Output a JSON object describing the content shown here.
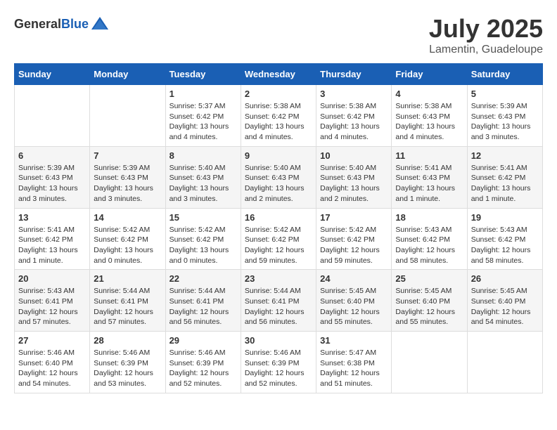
{
  "header": {
    "logo_general": "General",
    "logo_blue": "Blue",
    "month_year": "July 2025",
    "location": "Lamentin, Guadeloupe"
  },
  "days_of_week": [
    "Sunday",
    "Monday",
    "Tuesday",
    "Wednesday",
    "Thursday",
    "Friday",
    "Saturday"
  ],
  "weeks": [
    [
      {
        "day": "",
        "sunrise": "",
        "sunset": "",
        "daylight": ""
      },
      {
        "day": "",
        "sunrise": "",
        "sunset": "",
        "daylight": ""
      },
      {
        "day": "1",
        "sunrise": "Sunrise: 5:37 AM",
        "sunset": "Sunset: 6:42 PM",
        "daylight": "Daylight: 13 hours and 4 minutes."
      },
      {
        "day": "2",
        "sunrise": "Sunrise: 5:38 AM",
        "sunset": "Sunset: 6:42 PM",
        "daylight": "Daylight: 13 hours and 4 minutes."
      },
      {
        "day": "3",
        "sunrise": "Sunrise: 5:38 AM",
        "sunset": "Sunset: 6:42 PM",
        "daylight": "Daylight: 13 hours and 4 minutes."
      },
      {
        "day": "4",
        "sunrise": "Sunrise: 5:38 AM",
        "sunset": "Sunset: 6:43 PM",
        "daylight": "Daylight: 13 hours and 4 minutes."
      },
      {
        "day": "5",
        "sunrise": "Sunrise: 5:39 AM",
        "sunset": "Sunset: 6:43 PM",
        "daylight": "Daylight: 13 hours and 3 minutes."
      }
    ],
    [
      {
        "day": "6",
        "sunrise": "Sunrise: 5:39 AM",
        "sunset": "Sunset: 6:43 PM",
        "daylight": "Daylight: 13 hours and 3 minutes."
      },
      {
        "day": "7",
        "sunrise": "Sunrise: 5:39 AM",
        "sunset": "Sunset: 6:43 PM",
        "daylight": "Daylight: 13 hours and 3 minutes."
      },
      {
        "day": "8",
        "sunrise": "Sunrise: 5:40 AM",
        "sunset": "Sunset: 6:43 PM",
        "daylight": "Daylight: 13 hours and 3 minutes."
      },
      {
        "day": "9",
        "sunrise": "Sunrise: 5:40 AM",
        "sunset": "Sunset: 6:43 PM",
        "daylight": "Daylight: 13 hours and 2 minutes."
      },
      {
        "day": "10",
        "sunrise": "Sunrise: 5:40 AM",
        "sunset": "Sunset: 6:43 PM",
        "daylight": "Daylight: 13 hours and 2 minutes."
      },
      {
        "day": "11",
        "sunrise": "Sunrise: 5:41 AM",
        "sunset": "Sunset: 6:43 PM",
        "daylight": "Daylight: 13 hours and 1 minute."
      },
      {
        "day": "12",
        "sunrise": "Sunrise: 5:41 AM",
        "sunset": "Sunset: 6:42 PM",
        "daylight": "Daylight: 13 hours and 1 minute."
      }
    ],
    [
      {
        "day": "13",
        "sunrise": "Sunrise: 5:41 AM",
        "sunset": "Sunset: 6:42 PM",
        "daylight": "Daylight: 13 hours and 1 minute."
      },
      {
        "day": "14",
        "sunrise": "Sunrise: 5:42 AM",
        "sunset": "Sunset: 6:42 PM",
        "daylight": "Daylight: 13 hours and 0 minutes."
      },
      {
        "day": "15",
        "sunrise": "Sunrise: 5:42 AM",
        "sunset": "Sunset: 6:42 PM",
        "daylight": "Daylight: 13 hours and 0 minutes."
      },
      {
        "day": "16",
        "sunrise": "Sunrise: 5:42 AM",
        "sunset": "Sunset: 6:42 PM",
        "daylight": "Daylight: 12 hours and 59 minutes."
      },
      {
        "day": "17",
        "sunrise": "Sunrise: 5:42 AM",
        "sunset": "Sunset: 6:42 PM",
        "daylight": "Daylight: 12 hours and 59 minutes."
      },
      {
        "day": "18",
        "sunrise": "Sunrise: 5:43 AM",
        "sunset": "Sunset: 6:42 PM",
        "daylight": "Daylight: 12 hours and 58 minutes."
      },
      {
        "day": "19",
        "sunrise": "Sunrise: 5:43 AM",
        "sunset": "Sunset: 6:42 PM",
        "daylight": "Daylight: 12 hours and 58 minutes."
      }
    ],
    [
      {
        "day": "20",
        "sunrise": "Sunrise: 5:43 AM",
        "sunset": "Sunset: 6:41 PM",
        "daylight": "Daylight: 12 hours and 57 minutes."
      },
      {
        "day": "21",
        "sunrise": "Sunrise: 5:44 AM",
        "sunset": "Sunset: 6:41 PM",
        "daylight": "Daylight: 12 hours and 57 minutes."
      },
      {
        "day": "22",
        "sunrise": "Sunrise: 5:44 AM",
        "sunset": "Sunset: 6:41 PM",
        "daylight": "Daylight: 12 hours and 56 minutes."
      },
      {
        "day": "23",
        "sunrise": "Sunrise: 5:44 AM",
        "sunset": "Sunset: 6:41 PM",
        "daylight": "Daylight: 12 hours and 56 minutes."
      },
      {
        "day": "24",
        "sunrise": "Sunrise: 5:45 AM",
        "sunset": "Sunset: 6:40 PM",
        "daylight": "Daylight: 12 hours and 55 minutes."
      },
      {
        "day": "25",
        "sunrise": "Sunrise: 5:45 AM",
        "sunset": "Sunset: 6:40 PM",
        "daylight": "Daylight: 12 hours and 55 minutes."
      },
      {
        "day": "26",
        "sunrise": "Sunrise: 5:45 AM",
        "sunset": "Sunset: 6:40 PM",
        "daylight": "Daylight: 12 hours and 54 minutes."
      }
    ],
    [
      {
        "day": "27",
        "sunrise": "Sunrise: 5:46 AM",
        "sunset": "Sunset: 6:40 PM",
        "daylight": "Daylight: 12 hours and 54 minutes."
      },
      {
        "day": "28",
        "sunrise": "Sunrise: 5:46 AM",
        "sunset": "Sunset: 6:39 PM",
        "daylight": "Daylight: 12 hours and 53 minutes."
      },
      {
        "day": "29",
        "sunrise": "Sunrise: 5:46 AM",
        "sunset": "Sunset: 6:39 PM",
        "daylight": "Daylight: 12 hours and 52 minutes."
      },
      {
        "day": "30",
        "sunrise": "Sunrise: 5:46 AM",
        "sunset": "Sunset: 6:39 PM",
        "daylight": "Daylight: 12 hours and 52 minutes."
      },
      {
        "day": "31",
        "sunrise": "Sunrise: 5:47 AM",
        "sunset": "Sunset: 6:38 PM",
        "daylight": "Daylight: 12 hours and 51 minutes."
      },
      {
        "day": "",
        "sunrise": "",
        "sunset": "",
        "daylight": ""
      },
      {
        "day": "",
        "sunrise": "",
        "sunset": "",
        "daylight": ""
      }
    ]
  ]
}
